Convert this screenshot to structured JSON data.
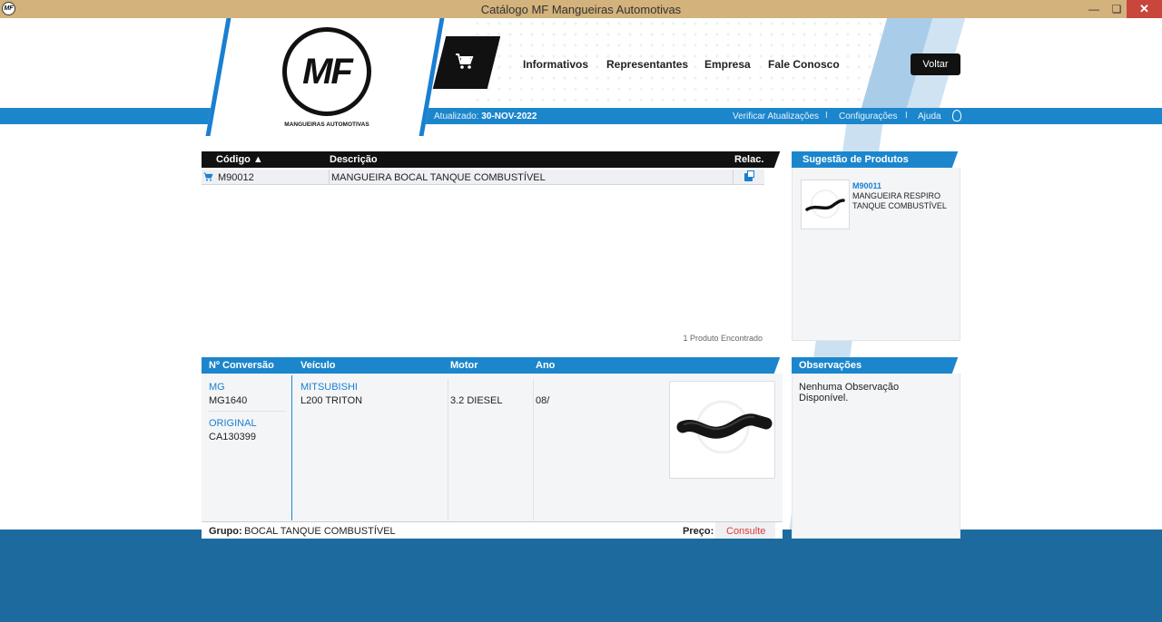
{
  "window": {
    "title": "Catálogo MF Mangueiras Automotivas",
    "icon_label": "MF",
    "minimize_icon": "minimize-icon",
    "maximize_icon": "maximize-icon",
    "close_icon": "close-icon"
  },
  "header": {
    "logo_text": "MF",
    "logo_tagline": "MANGUEIRAS AUTOMOTIVAS",
    "nav": [
      "Informativos",
      "Representantes",
      "Empresa",
      "Fale Conosco"
    ],
    "back_button": "Voltar",
    "updated_label": "Atualizado:",
    "updated_date": "30-NOV-2022",
    "links": [
      "Verificar Atualizações",
      "Configurações",
      "Ajuda"
    ],
    "separator": "I"
  },
  "product_list": {
    "columns": [
      "Código ▲",
      "Descrição",
      "Relac."
    ],
    "rows": [
      {
        "code": "M90012",
        "description": "MANGUEIRA BOCAL TANQUE COMBUSTÍVEL"
      }
    ],
    "found_text": "1 Produto Encontrado"
  },
  "suggestions": {
    "title": "Sugestão de Produtos",
    "items": [
      {
        "code": "M90011",
        "description": "MANGUEIRA RESPIRO TANQUE COMBUSTÍVEL"
      }
    ]
  },
  "details": {
    "columns": [
      "Nº Conversão",
      "Veículo",
      "Motor",
      "Ano"
    ],
    "conversions": [
      {
        "brand": "MG",
        "code": "MG1640"
      },
      {
        "brand": "ORIGINAL",
        "code": "CA130399"
      }
    ],
    "vehicle_brand": "MITSUBISHI",
    "vehicle_model": "L200 TRITON",
    "motor": "3.2 DIESEL",
    "year": "08/",
    "group_label": "Grupo:",
    "group_value": "BOCAL TANQUE COMBUSTÍVEL",
    "price_label": "Preço:",
    "price_value": "Consulte"
  },
  "observations": {
    "title": "Observações",
    "text": "Nenhuma Observação Disponível."
  },
  "colors": {
    "accent": "#1c86cc",
    "dark": "#111111",
    "titlebar": "#d3b27b",
    "close": "#c9463d",
    "price": "#e23a3a"
  }
}
